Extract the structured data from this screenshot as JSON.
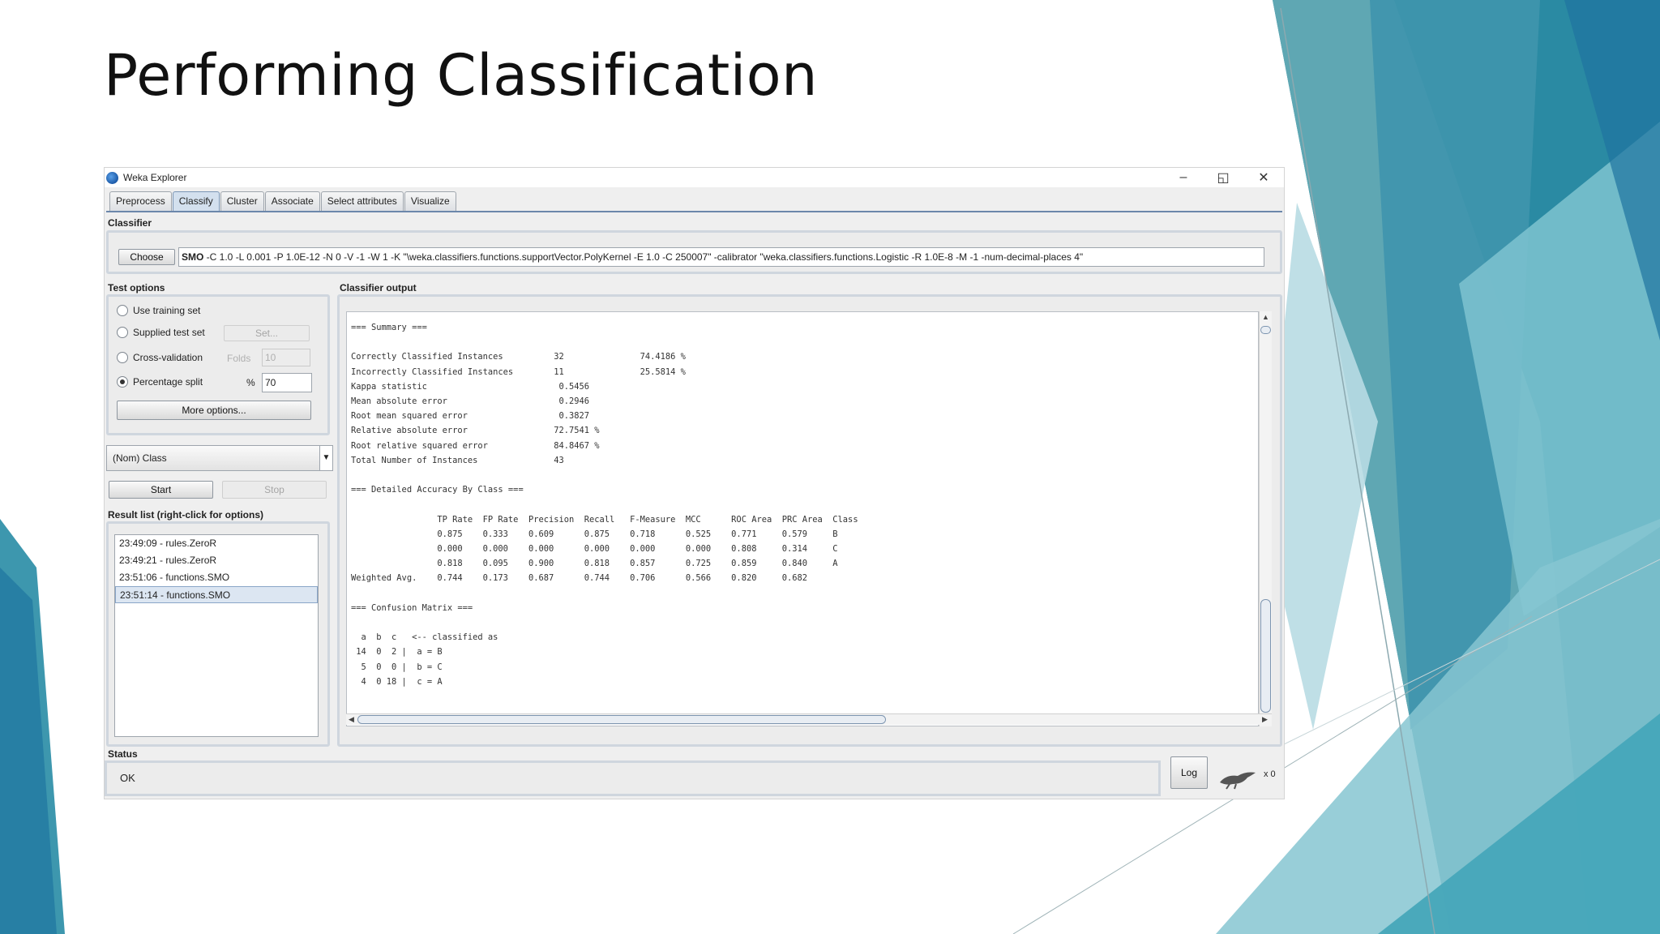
{
  "slide": {
    "title": "Performing Classification"
  },
  "window": {
    "title": "Weka Explorer",
    "controls": {
      "minimize": "–",
      "maximize": "◱",
      "close": "✕"
    },
    "tabs": [
      "Preprocess",
      "Classify",
      "Cluster",
      "Associate",
      "Select attributes",
      "Visualize"
    ],
    "active_tab": "Classify"
  },
  "classifier": {
    "section_label": "Classifier",
    "choose_label": "Choose",
    "name": "SMO",
    "options": " -C 1.0 -L 0.001 -P 1.0E-12 -N 0 -V -1 -W 1 -K \"\\weka.classifiers.functions.supportVector.PolyKernel -E 1.0 -C 250007\" -calibrator \"weka.classifiers.functions.Logistic -R 1.0E-8 -M -1 -num-decimal-places 4\""
  },
  "test_options": {
    "section_label": "Test options",
    "use_training_set": "Use training set",
    "supplied_test_set": "Supplied test set",
    "set_label": "Set...",
    "cross_validation": "Cross-validation",
    "folds_label": "Folds",
    "folds_value": "10",
    "percentage_split": "Percentage split",
    "percent_symbol": "%",
    "percentage_value": "70",
    "more_options": "More options...",
    "selected": "percentage_split"
  },
  "class_select": {
    "value": "(Nom) Class"
  },
  "actions": {
    "start": "Start",
    "stop": "Stop"
  },
  "result_list": {
    "section_label": "Result list (right-click for options)",
    "items": [
      "23:49:09 - rules.ZeroR",
      "23:49:21 - rules.ZeroR",
      "23:51:06 - functions.SMO",
      "23:51:14 - functions.SMO"
    ],
    "selected_index": 3
  },
  "output": {
    "section_label": "Classifier output",
    "text": "=== Summary ===\n\nCorrectly Classified Instances          32               74.4186 %\nIncorrectly Classified Instances        11               25.5814 %\nKappa statistic                          0.5456\nMean absolute error                      0.2946\nRoot mean squared error                  0.3827\nRelative absolute error                 72.7541 %\nRoot relative squared error             84.8467 %\nTotal Number of Instances               43\n\n=== Detailed Accuracy By Class ===\n\n                 TP Rate  FP Rate  Precision  Recall   F-Measure  MCC      ROC Area  PRC Area  Class\n                 0.875    0.333    0.609      0.875    0.718      0.525    0.771     0.579     B\n                 0.000    0.000    0.000      0.000    0.000      0.000    0.808     0.314     C\n                 0.818    0.095    0.900      0.818    0.857      0.725    0.859     0.840     A\nWeighted Avg.    0.744    0.173    0.687      0.744    0.706      0.566    0.820     0.682\n\n=== Confusion Matrix ===\n\n  a  b  c   <-- classified as\n 14  0  2 |  a = B\n  5  0  0 |  b = C\n  4  0 18 |  c = A"
  },
  "status": {
    "section_label": "Status",
    "text": "OK",
    "log_label": "Log",
    "count": "x 0"
  },
  "colors": {
    "accent": "#6c87ab",
    "teal": "#2d8fa6",
    "light_teal": "#a9d6de",
    "dark_teal": "#1f6f8b"
  }
}
